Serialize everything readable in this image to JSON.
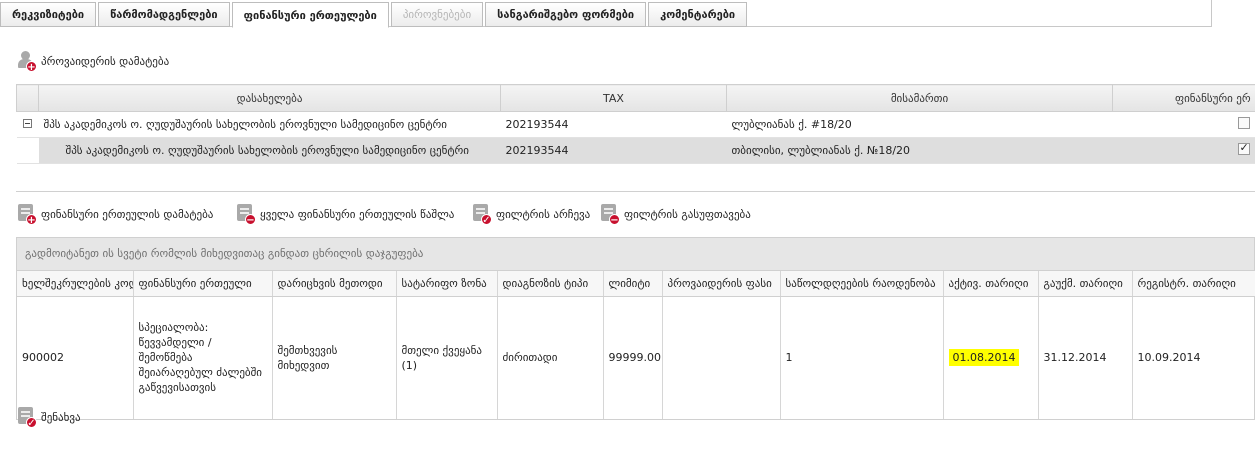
{
  "tabs": [
    {
      "label": "რეკვიზიტები"
    },
    {
      "label": "წარმომადგენლები"
    },
    {
      "label": "ფინანსური ერთეულები"
    },
    {
      "label": "პიროვნებები"
    },
    {
      "label": "სანგარიშგებო ფორმები"
    },
    {
      "label": "კომენტარები"
    }
  ],
  "providers": {
    "add_label": "პროვაიდერის დამატება",
    "columns": {
      "name": "დასახელება",
      "tax": "TAX",
      "address": "მისამართი",
      "financial": "ფინანსური ერ"
    },
    "rows": [
      {
        "name": "შპს აკადემიკოს ო. ღუდუშაურის სახელობის ეროვნული სამედიცინო ცენტრი",
        "tax": "202193544",
        "address": "ლუბლიანას ქ. #18/20"
      },
      {
        "name": "შპს აკადემიკოს ო. ღუდუშაურის სახელობის ეროვნული სამედიცინო ცენტრი",
        "tax": "202193544",
        "address": "თბილისი, ლუბლიანას ქ. №18/20"
      }
    ]
  },
  "toolbar": {
    "add_unit": "ფინანსური ერთეულის დამატება",
    "delete_all": "ყველა ფინანსური ერთეულის წაშლა",
    "select_filter": "ფილტრის არჩევა",
    "clear_filter": "ფილტრის გასუფთავება"
  },
  "units": {
    "group_hint": "გადმოიტანეთ ის სვეტი რომლის მიხედვითაც გინდათ ცხრილის დაჯგუფება",
    "columns": [
      "ხელშეკრულების კოდი",
      "ფინანსური ერთეული",
      "დარიცხვის მეთოდი",
      "სატარიფო ზონა",
      "დიაგნოზის ტიპი",
      "ლიმიტი",
      "პროვაიდერის ფასი",
      "საწოლდღეების რაოდენობა",
      "აქტივ. თარიღი",
      "გაუქმ. თარიღი",
      "რეგისტრ. თარიღი"
    ],
    "row": {
      "code": "900002",
      "unit_lines": [
        "სპეციალობა:",
        "წევვამდელი /",
        "შემოწმება",
        "შეიარაღებულ ძალებში",
        "გაწვევისათვის"
      ],
      "method_lines": [
        "შემთხვევის",
        "მიხედვით"
      ],
      "zone_lines": [
        "მთელი ქვეყანა",
        "(1)"
      ],
      "diagnosis": "ძირითადი",
      "limit": "99999.00",
      "provider_price": "",
      "bed_days": "1",
      "activation_date": "01.08.2014",
      "cancel_date": "31.12.2014",
      "registration_date": "10.09.2014"
    }
  },
  "save_label": "შენახვა",
  "colors": {
    "highlight": "#ffff00",
    "badge": "#c8102e",
    "icon_gray": "#a9a9a9"
  }
}
